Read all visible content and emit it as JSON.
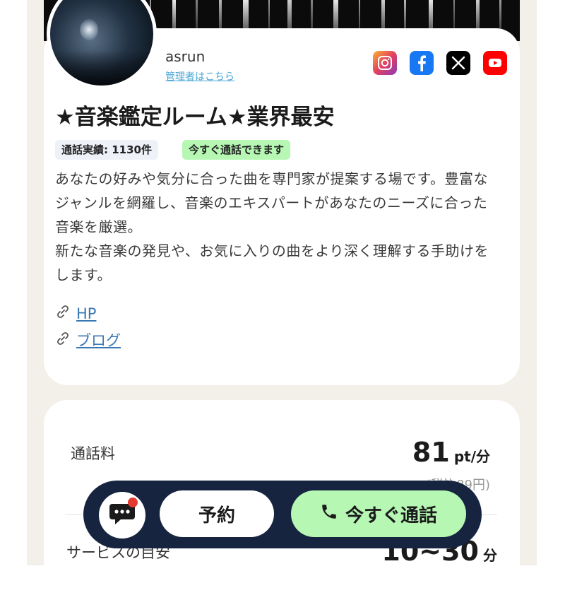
{
  "profile": {
    "username": "asrun",
    "admin_link": "管理者はこちら",
    "title": "★音楽鑑定ルーム★業界最安",
    "badges": {
      "call_record": "通話実績: 1130件",
      "available": "今すぐ通話できます"
    },
    "description": [
      "あなたの好みや気分に合った曲を専門家が提案する場です。豊富なジャンルを網羅し、音楽のエキスパートがあなたのニーズに合った音楽を厳選。",
      "新たな音楽の発見や、お気に入りの曲をより深く理解する手助けをします。"
    ],
    "links": {
      "hp": "HP",
      "blog": "ブログ"
    },
    "social_icons": [
      "instagram-icon",
      "facebook-icon",
      "x-icon",
      "youtube-icon"
    ]
  },
  "pricing": {
    "call_fee_label": "通話料",
    "call_fee_value": "81",
    "call_fee_unit": "pt/分",
    "call_fee_tax": "(税込89円)",
    "service_label": "サービスの目安",
    "service_value": "10~30",
    "service_unit": "分"
  },
  "actions": {
    "reserve": "予約",
    "call_now": "今すぐ通話"
  },
  "colors": {
    "background": "#f3f0ea",
    "action_bar": "#16243f",
    "call_button": "#b6f7b4",
    "available_badge": "#b6f7b4",
    "record_badge": "#eef1f8",
    "link": "#3a78b5",
    "notification_dot": "#e23b2e"
  }
}
